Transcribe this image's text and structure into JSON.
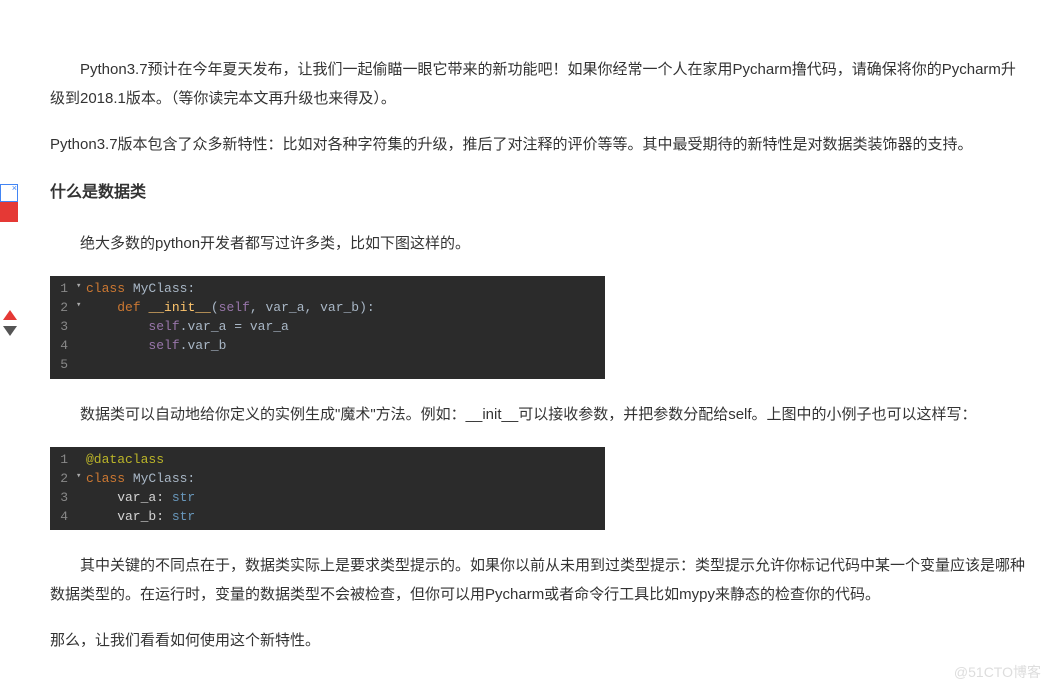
{
  "paragraphs": {
    "p1": "Python3.7预计在今年夏天发布，让我们一起偷瞄一眼它带来的新功能吧！如果你经常一个人在家用Pycharm撸代码，请确保将你的Pycharm升级到2018.1版本。（等你读完本文再升级也来得及）。",
    "p2": "Python3.7版本包含了众多新特性：比如对各种字符集的升级，推后了对注释的评价等等。其中最受期待的新特性是对数据类装饰器的支持。",
    "h2a": "什么是数据类",
    "p3": "绝大多数的python开发者都写过许多类，比如下图这样的。",
    "p4": "数据类可以自动地给你定义的实例生成\"魔术\"方法。例如：__init__可以接收参数，并把参数分配给self。上图中的小例子也可以这样写：",
    "p5": "其中关键的不同点在于，数据类实际上是要求类型提示的。如果你以前从未用到过类型提示：类型提示允许你标记代码中某一个变量应该是哪种数据类型的。在运行时，变量的数据类型不会被检查，但你可以用Pycharm或者命令行工具比如mypy来静态的检查你的代码。",
    "p6": "那么，让我们看看如何使用这个新特性。"
  },
  "code1": {
    "lines": [
      {
        "n": "1",
        "fold": "▾",
        "tokens": [
          [
            "kw",
            "class "
          ],
          [
            "id",
            "MyClass"
          ],
          [
            "op",
            ":"
          ]
        ]
      },
      {
        "n": "2",
        "fold": "▾",
        "tokens": [
          [
            "plain",
            "    "
          ],
          [
            "kw",
            "def "
          ],
          [
            "fn",
            "__init__"
          ],
          [
            "op",
            "("
          ],
          [
            "self",
            "self"
          ],
          [
            "op",
            ", var_a, var_b):"
          ]
        ]
      },
      {
        "n": "3",
        "fold": "",
        "tokens": [
          [
            "plain",
            "        "
          ],
          [
            "self",
            "self"
          ],
          [
            "op",
            ".var_a "
          ],
          [
            "op",
            "= var_a"
          ]
        ]
      },
      {
        "n": "4",
        "fold": "",
        "tokens": [
          [
            "plain",
            "        "
          ],
          [
            "self",
            "self"
          ],
          [
            "op",
            ".var_b"
          ]
        ]
      },
      {
        "n": "5",
        "fold": "",
        "tokens": [
          [
            "plain",
            ""
          ]
        ]
      }
    ]
  },
  "code2": {
    "lines": [
      {
        "n": "1",
        "fold": "",
        "tokens": [
          [
            "decor",
            "@dataclass"
          ]
        ]
      },
      {
        "n": "2",
        "fold": "▾",
        "tokens": [
          [
            "kw",
            "class "
          ],
          [
            "id",
            "MyClass"
          ],
          [
            "op",
            ":"
          ]
        ]
      },
      {
        "n": "3",
        "fold": "",
        "tokens": [
          [
            "plain",
            "    var_a: "
          ],
          [
            "type",
            "str"
          ]
        ]
      },
      {
        "n": "4",
        "fold": "",
        "tokens": [
          [
            "plain",
            "    var_b: "
          ],
          [
            "type",
            "str"
          ]
        ]
      }
    ]
  },
  "watermark": "@51CTO博客",
  "ad_label": "×"
}
